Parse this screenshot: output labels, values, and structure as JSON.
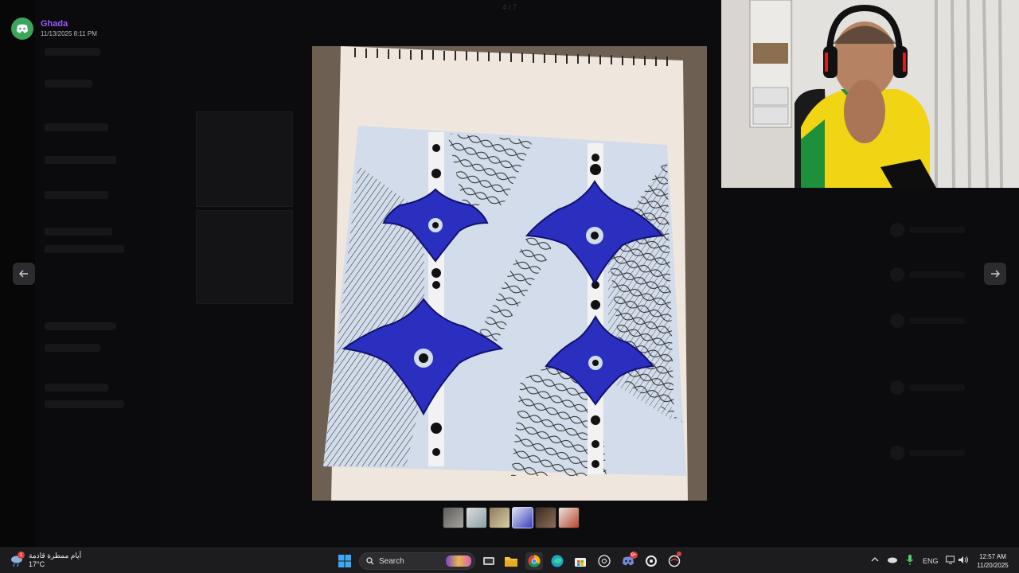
{
  "viewer": {
    "uploader_name": "Ghada",
    "uploaded_at": "11/13/2025 8:11 PM",
    "image_counter": "4 / 7",
    "prev_icon": "arrow-left-icon",
    "next_icon": "arrow-right-icon",
    "thumbnails": [
      {
        "label": "thumb-1"
      },
      {
        "label": "thumb-2"
      },
      {
        "label": "thumb-3"
      },
      {
        "label": "thumb-4",
        "active": true
      },
      {
        "label": "thumb-5"
      },
      {
        "label": "thumb-6"
      }
    ]
  },
  "taskbar": {
    "weather_text": "أيام ممطرة قادمة",
    "weather_temp": "17°C",
    "weather_badge": "1",
    "search_label": "Search",
    "pinned": [
      "start-icon",
      "file-explorer-icon",
      "chrome-icon",
      "edge-icon",
      "store-icon",
      "chatgpt-icon",
      "discord-icon",
      "steelseries-icon",
      "browser-icon"
    ],
    "discord_badge": "9+",
    "language": "ENG",
    "time": "12:57 AM",
    "date": "11/20/2025"
  },
  "colors": {
    "accent_purple": "#9b59ff",
    "discord_green": "#3ba55c",
    "taskbar_bg": "#1c1c1f"
  }
}
